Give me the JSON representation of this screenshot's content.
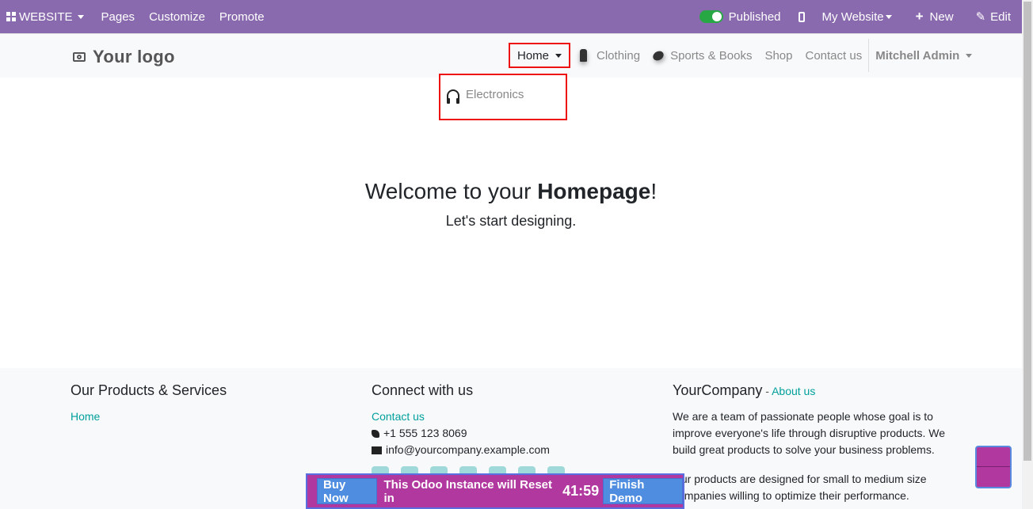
{
  "adminbar": {
    "app_menu": "WEBSITE",
    "menu": [
      "Pages",
      "Customize",
      "Promote"
    ],
    "published": "Published",
    "website_selector": "My Website",
    "new": "New",
    "edit": "Edit"
  },
  "header": {
    "logo": "Your logo",
    "nav": {
      "home": "Home",
      "clothing": "Clothing",
      "sports_books": "Sports & Books",
      "shop": "Shop",
      "contact": "Contact us",
      "user": "Mitchell Admin"
    },
    "dropdown": {
      "electronics": "Electronics"
    }
  },
  "main": {
    "title_prefix": "Welcome to your ",
    "title_bold": "Homepage",
    "title_suffix": "!",
    "subtitle": "Let's start designing."
  },
  "footer": {
    "col1": {
      "title": "Our Products & Services",
      "link": "Home"
    },
    "col2": {
      "title": "Connect with us",
      "link": "Contact us",
      "phone": "+1 555 123 8069",
      "email": "info@yourcompany.example.com"
    },
    "col3": {
      "title": "YourCompany",
      "title_sep": " - ",
      "about_link": "About us",
      "p1": "We are a team of passionate people whose goal is to improve everyone's life through disruptive products. We build great products to solve your business problems.",
      "p2": "Our products are designed for small to medium size companies willing to optimize their performance."
    }
  },
  "demobar": {
    "buy_now": "Buy Now",
    "message": "This Odoo Instance will Reset in",
    "timer": "41:59",
    "finish": "Finish Demo"
  }
}
